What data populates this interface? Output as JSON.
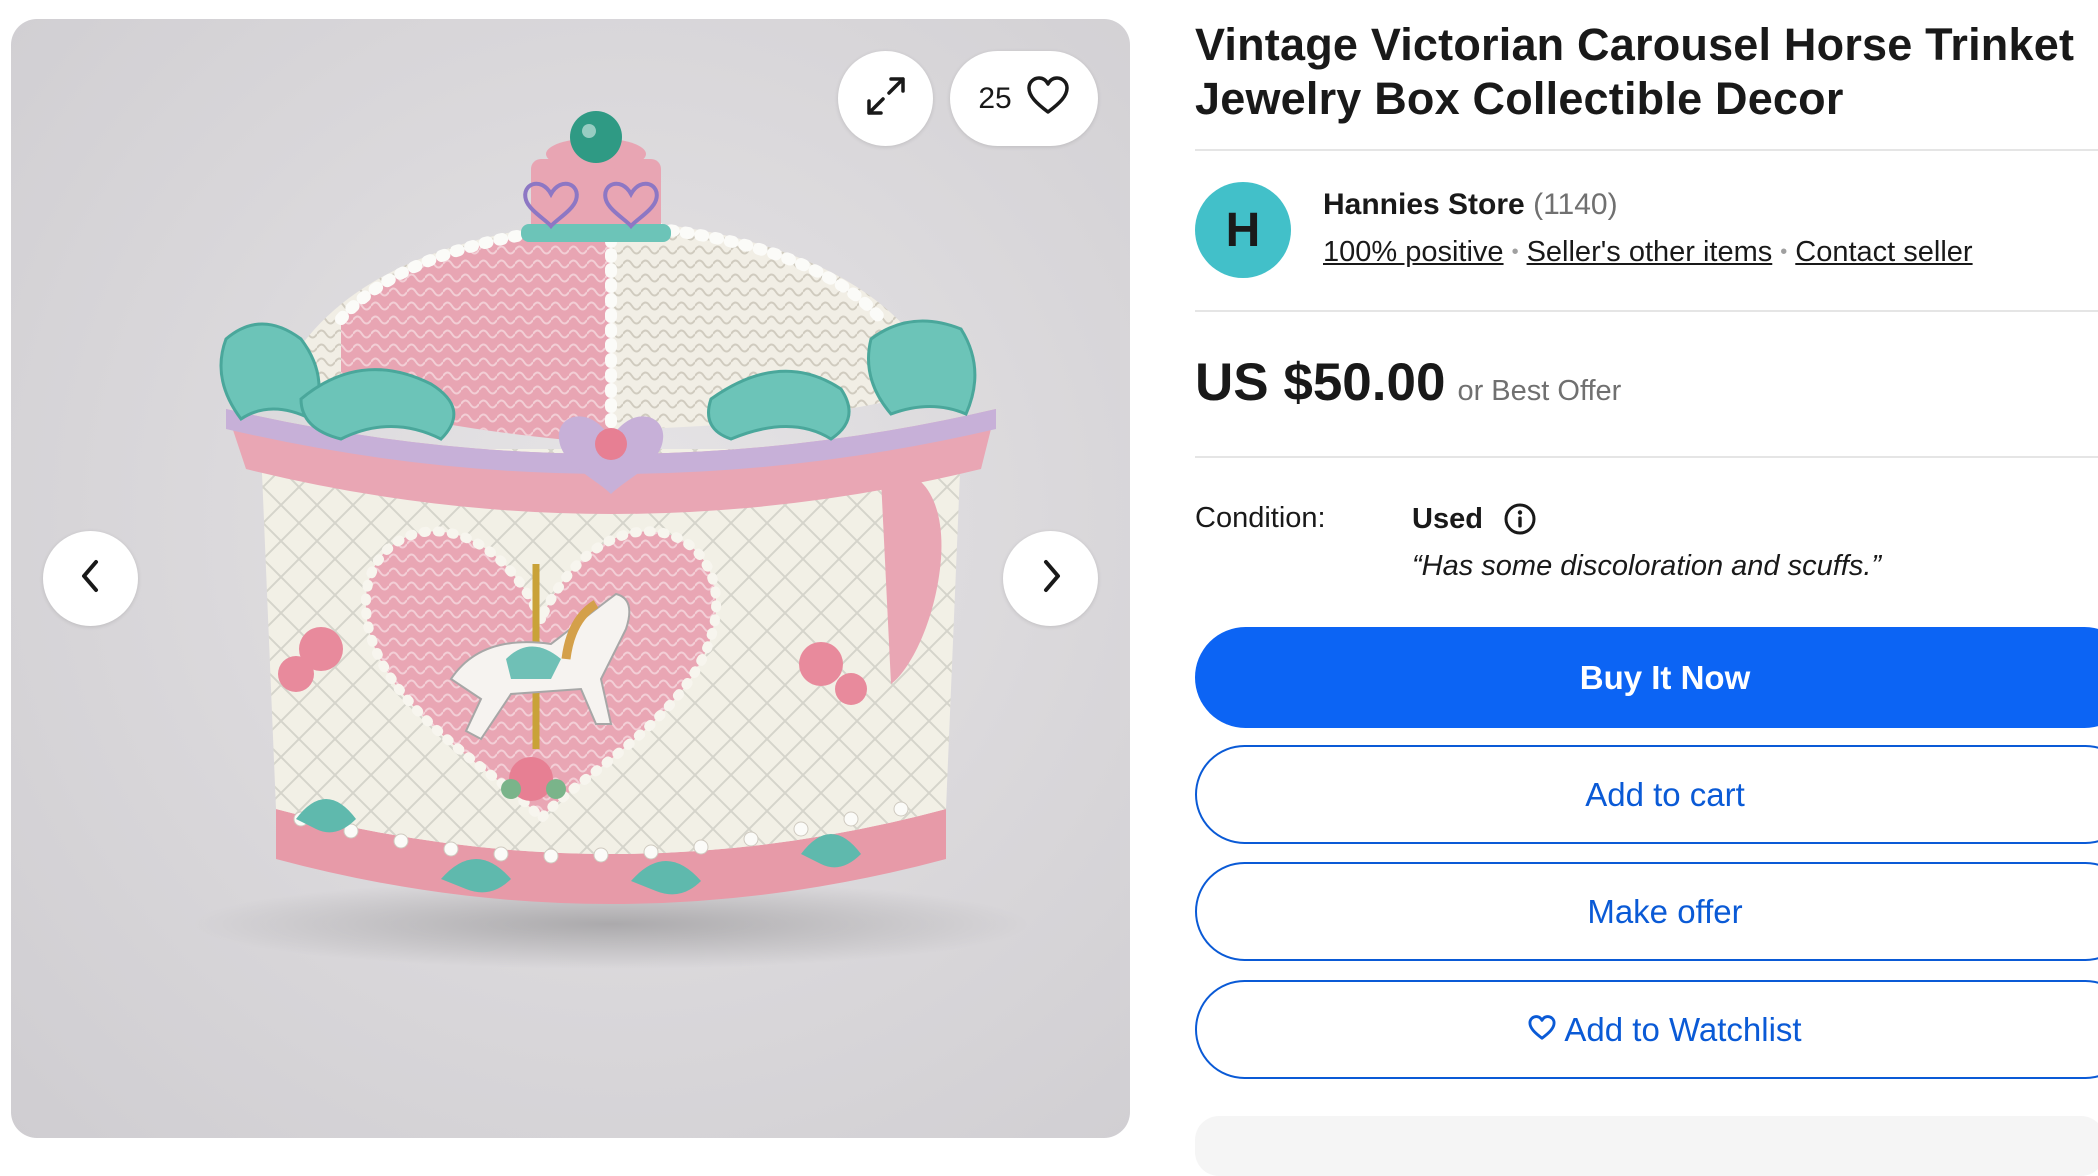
{
  "gallery": {
    "watch_count": "25",
    "icons": [
      "expand-icon",
      "heart-icon",
      "chevron-left-icon",
      "chevron-right-icon"
    ]
  },
  "listing": {
    "title_line1": "Vintage Victorian Carousel Horse Trinket",
    "title_line2": "Jewelry Box Collectible Decor"
  },
  "seller": {
    "avatar_letter": "H",
    "avatar_color": "#42c0c9",
    "name": "Hannies Store",
    "feedback_count": "(1140)",
    "links": [
      "100% positive",
      "Seller's other items",
      "Contact seller"
    ]
  },
  "price": {
    "amount": "US $50.00",
    "best_offer": "or Best Offer"
  },
  "condition": {
    "label": "Condition:",
    "value": "Used",
    "description": "“Has some discoloration and scuffs.”"
  },
  "actions": {
    "buy_now": "Buy It Now",
    "add_to_cart": "Add to cart",
    "make_offer": "Make offer",
    "add_to_watchlist": "Add to Watchlist"
  },
  "colors": {
    "primary_blue": "#0c64f4",
    "outline_blue": "#0a5ad6",
    "text": "#191919",
    "muted": "#707070"
  }
}
